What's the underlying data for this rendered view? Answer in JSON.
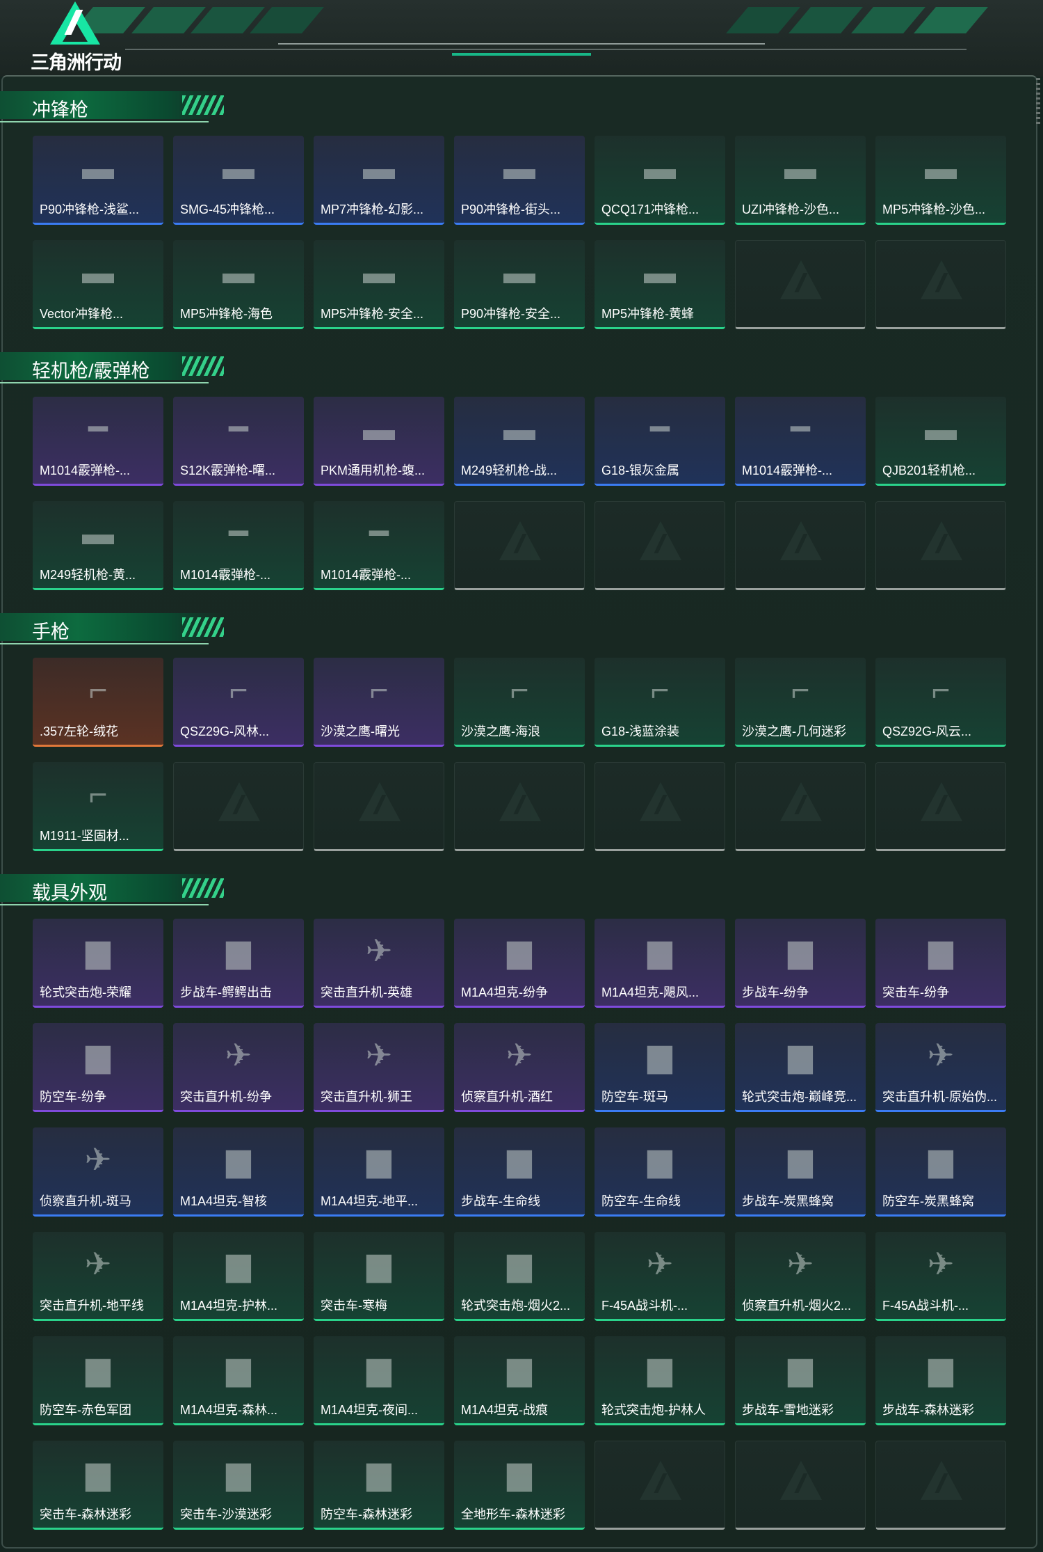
{
  "logo": {
    "text": "三角洲行动"
  },
  "colors": {
    "accent": "#18e6a4",
    "purple": "#7f4bdb",
    "blue": "#3b7cf3",
    "green": "#2ad38b",
    "orange": "#e1783a",
    "empty": "#9aa19e"
  },
  "sections": [
    {
      "title": "冲锋枪",
      "items": [
        {
          "label": "P90冲锋枪-浅鲨...",
          "rarity": "blue",
          "icon": "smg-icon"
        },
        {
          "label": "SMG-45冲锋枪...",
          "rarity": "blue",
          "icon": "smg-icon"
        },
        {
          "label": "MP7冲锋枪-幻影...",
          "rarity": "blue",
          "icon": "smg-icon"
        },
        {
          "label": "P90冲锋枪-街头...",
          "rarity": "blue",
          "icon": "smg-icon"
        },
        {
          "label": "QCQ171冲锋枪...",
          "rarity": "green",
          "icon": "smg-icon"
        },
        {
          "label": "UZI冲锋枪-沙色...",
          "rarity": "green",
          "icon": "smg-icon"
        },
        {
          "label": "MP5冲锋枪-沙色...",
          "rarity": "green",
          "icon": "smg-icon"
        },
        {
          "label": "Vector冲锋枪...",
          "rarity": "green",
          "icon": "smg-icon"
        },
        {
          "label": "MP5冲锋枪-海色",
          "rarity": "green",
          "icon": "smg-icon"
        },
        {
          "label": "MP5冲锋枪-安全...",
          "rarity": "green",
          "icon": "smg-icon"
        },
        {
          "label": "P90冲锋枪-安全...",
          "rarity": "green",
          "icon": "smg-icon"
        },
        {
          "label": "MP5冲锋枪-黄蜂",
          "rarity": "green",
          "icon": "smg-icon"
        },
        {
          "label": "",
          "rarity": "empty",
          "icon": ""
        },
        {
          "label": "",
          "rarity": "empty",
          "icon": ""
        }
      ]
    },
    {
      "title": "轻机枪/霰弹枪",
      "items": [
        {
          "label": "M1014霰弹枪-...",
          "rarity": "purple",
          "icon": "shotgun-icon"
        },
        {
          "label": "S12K霰弹枪-曙...",
          "rarity": "purple",
          "icon": "shotgun-icon"
        },
        {
          "label": "PKM通用机枪-蝮...",
          "rarity": "purple",
          "icon": "lmg-icon"
        },
        {
          "label": "M249轻机枪-战...",
          "rarity": "blue",
          "icon": "lmg-icon"
        },
        {
          "label": "G18-银灰金属",
          "rarity": "blue",
          "icon": "shotgun-icon"
        },
        {
          "label": "M1014霰弹枪-...",
          "rarity": "blue",
          "icon": "shotgun-icon"
        },
        {
          "label": "QJB201轻机枪...",
          "rarity": "green",
          "icon": "lmg-icon"
        },
        {
          "label": "M249轻机枪-黄...",
          "rarity": "green",
          "icon": "lmg-icon"
        },
        {
          "label": "M1014霰弹枪-...",
          "rarity": "green",
          "icon": "shotgun-icon"
        },
        {
          "label": "M1014霰弹枪-...",
          "rarity": "green",
          "icon": "shotgun-icon"
        },
        {
          "label": "",
          "rarity": "empty",
          "icon": ""
        },
        {
          "label": "",
          "rarity": "empty",
          "icon": ""
        },
        {
          "label": "",
          "rarity": "empty",
          "icon": ""
        },
        {
          "label": "",
          "rarity": "empty",
          "icon": ""
        }
      ]
    },
    {
      "title": "手枪",
      "items": [
        {
          "label": ".357左轮-绒花",
          "rarity": "orange",
          "icon": "revolver-icon"
        },
        {
          "label": "QSZ29G-风林...",
          "rarity": "purple",
          "icon": "pistol-icon"
        },
        {
          "label": "沙漠之鹰-曙光",
          "rarity": "purple",
          "icon": "pistol-icon"
        },
        {
          "label": "沙漠之鹰-海浪",
          "rarity": "green",
          "icon": "pistol-icon"
        },
        {
          "label": "G18-浅蓝涂装",
          "rarity": "green",
          "icon": "pistol-icon"
        },
        {
          "label": "沙漠之鹰-几何迷彩",
          "rarity": "green",
          "icon": "pistol-icon"
        },
        {
          "label": "QSZ92G-风云...",
          "rarity": "green",
          "icon": "pistol-icon"
        },
        {
          "label": "M1911-坚固材...",
          "rarity": "green",
          "icon": "pistol-icon"
        },
        {
          "label": "",
          "rarity": "empty",
          "icon": ""
        },
        {
          "label": "",
          "rarity": "empty",
          "icon": ""
        },
        {
          "label": "",
          "rarity": "empty",
          "icon": ""
        },
        {
          "label": "",
          "rarity": "empty",
          "icon": ""
        },
        {
          "label": "",
          "rarity": "empty",
          "icon": ""
        },
        {
          "label": "",
          "rarity": "empty",
          "icon": ""
        }
      ]
    },
    {
      "title": "载具外观",
      "items": [
        {
          "label": "轮式突击炮-荣耀",
          "rarity": "purple",
          "icon": "armored-car-icon"
        },
        {
          "label": "步战车-鳄鳄出击",
          "rarity": "purple",
          "icon": "armored-car-icon"
        },
        {
          "label": "突击直升机-英雄",
          "rarity": "purple",
          "icon": "helicopter-icon"
        },
        {
          "label": "M1A4坦克-纷争",
          "rarity": "purple",
          "icon": "tank-icon"
        },
        {
          "label": "M1A4坦克-飓风...",
          "rarity": "purple",
          "icon": "tank-icon"
        },
        {
          "label": "步战车-纷争",
          "rarity": "purple",
          "icon": "armored-car-icon"
        },
        {
          "label": "突击车-纷争",
          "rarity": "purple",
          "icon": "truck-icon"
        },
        {
          "label": "防空车-纷争",
          "rarity": "purple",
          "icon": "armored-car-icon"
        },
        {
          "label": "突击直升机-纷争",
          "rarity": "purple",
          "icon": "helicopter-icon"
        },
        {
          "label": "突击直升机-狮王",
          "rarity": "purple",
          "icon": "helicopter-icon"
        },
        {
          "label": "侦察直升机-酒红",
          "rarity": "purple",
          "icon": "helicopter-icon"
        },
        {
          "label": "防空车-斑马",
          "rarity": "blue",
          "icon": "armored-car-icon"
        },
        {
          "label": "轮式突击炮-巅峰竞...",
          "rarity": "blue",
          "icon": "armored-car-icon"
        },
        {
          "label": "突击直升机-原始伪...",
          "rarity": "blue",
          "icon": "helicopter-icon"
        },
        {
          "label": "侦察直升机-斑马",
          "rarity": "blue",
          "icon": "helicopter-icon"
        },
        {
          "label": "M1A4坦克-智核",
          "rarity": "blue",
          "icon": "tank-icon"
        },
        {
          "label": "M1A4坦克-地平...",
          "rarity": "blue",
          "icon": "tank-icon"
        },
        {
          "label": "步战车-生命线",
          "rarity": "blue",
          "icon": "armored-car-icon"
        },
        {
          "label": "防空车-生命线",
          "rarity": "blue",
          "icon": "armored-car-icon"
        },
        {
          "label": "步战车-炭黑蜂窝",
          "rarity": "blue",
          "icon": "armored-car-icon"
        },
        {
          "label": "防空车-炭黑蜂窝",
          "rarity": "blue",
          "icon": "armored-car-icon"
        },
        {
          "label": "突击直升机-地平线",
          "rarity": "green",
          "icon": "helicopter-icon"
        },
        {
          "label": "M1A4坦克-护林...",
          "rarity": "green",
          "icon": "tank-icon"
        },
        {
          "label": "突击车-寒梅",
          "rarity": "green",
          "icon": "truck-icon"
        },
        {
          "label": "轮式突击炮-烟火2...",
          "rarity": "green",
          "icon": "armored-car-icon"
        },
        {
          "label": "F-45A战斗机-...",
          "rarity": "green",
          "icon": "jet-icon"
        },
        {
          "label": "侦察直升机-烟火2...",
          "rarity": "green",
          "icon": "helicopter-icon"
        },
        {
          "label": "F-45A战斗机-...",
          "rarity": "green",
          "icon": "jet-icon"
        },
        {
          "label": "防空车-赤色军团",
          "rarity": "green",
          "icon": "armored-car-icon"
        },
        {
          "label": "M1A4坦克-森林...",
          "rarity": "green",
          "icon": "tank-icon"
        },
        {
          "label": "M1A4坦克-夜间...",
          "rarity": "green",
          "icon": "tank-icon"
        },
        {
          "label": "M1A4坦克-战痕",
          "rarity": "green",
          "icon": "tank-icon"
        },
        {
          "label": "轮式突击炮-护林人",
          "rarity": "green",
          "icon": "armored-car-icon"
        },
        {
          "label": "步战车-雪地迷彩",
          "rarity": "green",
          "icon": "armored-car-icon"
        },
        {
          "label": "步战车-森林迷彩",
          "rarity": "green",
          "icon": "armored-car-icon"
        },
        {
          "label": "突击车-森林迷彩",
          "rarity": "green",
          "icon": "truck-icon"
        },
        {
          "label": "突击车-沙漠迷彩",
          "rarity": "green",
          "icon": "truck-icon"
        },
        {
          "label": "防空车-森林迷彩",
          "rarity": "green",
          "icon": "armored-car-icon"
        },
        {
          "label": "全地形车-森林迷彩",
          "rarity": "green",
          "icon": "atv-icon"
        },
        {
          "label": "",
          "rarity": "empty",
          "icon": ""
        },
        {
          "label": "",
          "rarity": "empty",
          "icon": ""
        },
        {
          "label": "",
          "rarity": "empty",
          "icon": ""
        }
      ]
    }
  ]
}
